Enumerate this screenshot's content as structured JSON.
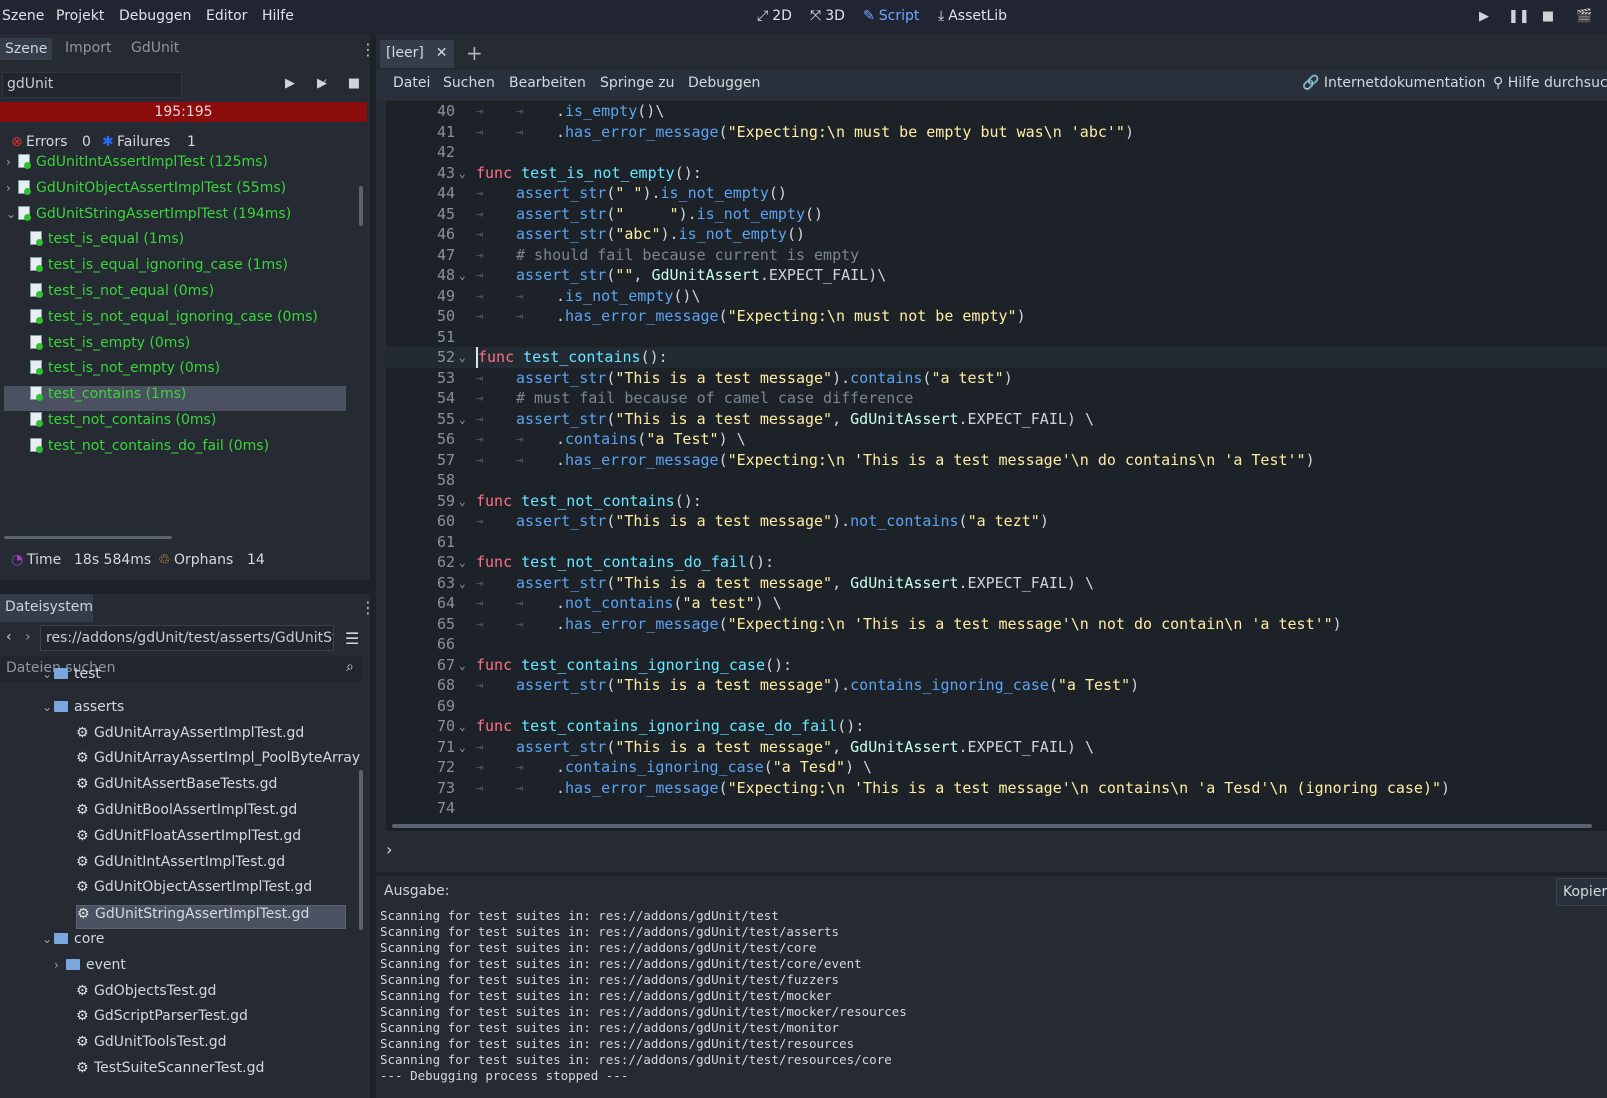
{
  "menu": [
    "Szene",
    "Projekt",
    "Debuggen",
    "Editor",
    "Hilfe"
  ],
  "workspaces": [
    {
      "label": "2D",
      "icon": "2d-icon"
    },
    {
      "label": "3D",
      "icon": "3d-icon"
    },
    {
      "label": "Script",
      "icon": "script-icon",
      "active": true
    },
    {
      "label": "AssetLib",
      "icon": "assetlib-icon"
    }
  ],
  "scene_dock": {
    "tabs": [
      "Szene",
      "Import",
      "GdUnit"
    ],
    "filter_value": "gdUnit",
    "progress_text": "195:195",
    "errors_label": "Errors",
    "errors_count": "0",
    "failures_label": "Failures",
    "failures_count": "1",
    "tests": [
      {
        "label": "GdUnitIntAssertImplTest (125ms)",
        "level": 0,
        "arrow": "›"
      },
      {
        "label": "GdUnitObjectAssertImplTest (55ms)",
        "level": 0,
        "arrow": "›"
      },
      {
        "label": "GdUnitStringAssertImplTest (194ms)",
        "level": 0,
        "arrow": "⌄"
      },
      {
        "label": "test_is_equal (1ms)",
        "level": 1
      },
      {
        "label": "test_is_equal_ignoring_case (1ms)",
        "level": 1
      },
      {
        "label": "test_is_not_equal (0ms)",
        "level": 1
      },
      {
        "label": "test_is_not_equal_ignoring_case (0ms)",
        "level": 1
      },
      {
        "label": "test_is_empty (0ms)",
        "level": 1
      },
      {
        "label": "test_is_not_empty (0ms)",
        "level": 1
      },
      {
        "label": "test_contains (1ms)",
        "level": 1,
        "selected": true
      },
      {
        "label": "test_not_contains (0ms)",
        "level": 1
      },
      {
        "label": "test_not_contains_do_fail (0ms)",
        "level": 1
      }
    ],
    "time_label": "Time",
    "time_value": "18s 584ms",
    "orphans_label": "Orphans",
    "orphans_value": "14"
  },
  "filesystem": {
    "tab": "Dateisystem",
    "path": "res://addons/gdUnit/test/asserts/GdUnitSt",
    "search_placeholder": "Dateien suchen",
    "items": [
      {
        "label": "test",
        "type": "folder",
        "indent": 54,
        "arrow": "⌄"
      },
      {
        "label": "asserts",
        "type": "folder",
        "indent": 54,
        "arrow": "⌄"
      },
      {
        "label": "GdUnitArrayAssertImplTest.gd",
        "type": "file",
        "indent": 76
      },
      {
        "label": "GdUnitArrayAssertImpl_PoolByteArray",
        "type": "file",
        "indent": 76
      },
      {
        "label": "GdUnitAssertBaseTests.gd",
        "type": "file",
        "indent": 76
      },
      {
        "label": "GdUnitBoolAssertImplTest.gd",
        "type": "file",
        "indent": 76
      },
      {
        "label": "GdUnitFloatAssertImplTest.gd",
        "type": "file",
        "indent": 76
      },
      {
        "label": "GdUnitIntAssertImplTest.gd",
        "type": "file",
        "indent": 76
      },
      {
        "label": "GdUnitObjectAssertImplTest.gd",
        "type": "file",
        "indent": 76
      },
      {
        "label": "GdUnitStringAssertImplTest.gd",
        "type": "file",
        "indent": 76,
        "selected": true
      },
      {
        "label": "core",
        "type": "folder",
        "indent": 54,
        "arrow": "⌄"
      },
      {
        "label": "event",
        "type": "folder",
        "indent": 66,
        "arrow": "›"
      },
      {
        "label": "GdObjectsTest.gd",
        "type": "file",
        "indent": 76
      },
      {
        "label": "GdScriptParserTest.gd",
        "type": "file",
        "indent": 76
      },
      {
        "label": "GdUnitToolsTest.gd",
        "type": "file",
        "indent": 76
      },
      {
        "label": "TestSuiteScannerTest.gd",
        "type": "file",
        "indent": 76
      }
    ]
  },
  "editor": {
    "open_tab": "[leer]",
    "menu": [
      "Datei",
      "Suchen",
      "Bearbeiten",
      "Springe zu",
      "Debuggen"
    ],
    "online_docs": "Internetdokumentation",
    "search_help": "Hilfe durchsuc",
    "current_line": 52,
    "lines": [
      {
        "n": 40,
        "indent": 2,
        "code": [
          [
            ".",
            ""
          ],
          [
            "is_empty",
            "mt"
          ],
          [
            "()\\",
            ""
          ]
        ]
      },
      {
        "n": 41,
        "indent": 2,
        "code": [
          [
            ".",
            ""
          ],
          [
            "has_error_message",
            "mt"
          ],
          [
            "(",
            ""
          ],
          [
            "\"Expecting:\\n must be empty but was\\n 'abc'\"",
            "st"
          ],
          [
            ")",
            ""
          ]
        ]
      },
      {
        "n": 42,
        "indent": 0,
        "code": []
      },
      {
        "n": 43,
        "indent": 0,
        "fold": true,
        "code": [
          [
            "func ",
            "kw"
          ],
          [
            "test_is_not_empty",
            "fn"
          ],
          [
            "():",
            ""
          ]
        ]
      },
      {
        "n": 44,
        "indent": 1,
        "code": [
          [
            "assert_str",
            "mt"
          ],
          [
            "(",
            ""
          ],
          [
            "\" \"",
            "st"
          ],
          [
            ").",
            ""
          ],
          [
            "is_not_empty",
            "mt"
          ],
          [
            "()",
            ""
          ]
        ]
      },
      {
        "n": 45,
        "indent": 1,
        "code": [
          [
            "assert_str",
            "mt"
          ],
          [
            "(",
            ""
          ],
          [
            "\"     \"",
            "st"
          ],
          [
            ").",
            ""
          ],
          [
            "is_not_empty",
            "mt"
          ],
          [
            "()",
            ""
          ]
        ]
      },
      {
        "n": 46,
        "indent": 1,
        "code": [
          [
            "assert_str",
            "mt"
          ],
          [
            "(",
            ""
          ],
          [
            "\"abc\"",
            "st"
          ],
          [
            ").",
            ""
          ],
          [
            "is_not_empty",
            "mt"
          ],
          [
            "()",
            ""
          ]
        ]
      },
      {
        "n": 47,
        "indent": 1,
        "code": [
          [
            "# should fail because current is empty",
            "cm"
          ]
        ]
      },
      {
        "n": 48,
        "indent": 1,
        "fold": true,
        "code": [
          [
            "assert_str",
            "mt"
          ],
          [
            "(",
            ""
          ],
          [
            "\"\"",
            "st"
          ],
          [
            ", ",
            ""
          ],
          [
            "GdUnitAssert",
            "cls"
          ],
          [
            ".EXPECT_FAIL)\\",
            ""
          ]
        ]
      },
      {
        "n": 49,
        "indent": 2,
        "code": [
          [
            ".",
            ""
          ],
          [
            "is_not_empty",
            "mt"
          ],
          [
            "()\\",
            ""
          ]
        ]
      },
      {
        "n": 50,
        "indent": 2,
        "code": [
          [
            ".",
            ""
          ],
          [
            "has_error_message",
            "mt"
          ],
          [
            "(",
            ""
          ],
          [
            "\"Expecting:\\n must not be empty\"",
            "st"
          ],
          [
            ")",
            ""
          ]
        ]
      },
      {
        "n": 51,
        "indent": 0,
        "code": []
      },
      {
        "n": 52,
        "indent": 0,
        "fold": true,
        "code": [
          [
            "func ",
            "kw"
          ],
          [
            "test_contains",
            "fn"
          ],
          [
            "():",
            ""
          ]
        ]
      },
      {
        "n": 53,
        "indent": 1,
        "code": [
          [
            "assert_str",
            "mt"
          ],
          [
            "(",
            ""
          ],
          [
            "\"This is a test message\"",
            "st"
          ],
          [
            ").",
            ""
          ],
          [
            "contains",
            "mt"
          ],
          [
            "(",
            ""
          ],
          [
            "\"a test\"",
            "st"
          ],
          [
            ")",
            ""
          ]
        ]
      },
      {
        "n": 54,
        "indent": 1,
        "code": [
          [
            "# must fail because of camel case difference",
            "cm"
          ]
        ]
      },
      {
        "n": 55,
        "indent": 1,
        "fold": true,
        "code": [
          [
            "assert_str",
            "mt"
          ],
          [
            "(",
            ""
          ],
          [
            "\"This is a test message\"",
            "st"
          ],
          [
            ", ",
            ""
          ],
          [
            "GdUnitAssert",
            "cls"
          ],
          [
            ".EXPECT_FAIL) \\",
            ""
          ]
        ]
      },
      {
        "n": 56,
        "indent": 2,
        "code": [
          [
            ".",
            ""
          ],
          [
            "contains",
            "mt"
          ],
          [
            "(",
            ""
          ],
          [
            "\"a Test\"",
            "st"
          ],
          [
            ") \\",
            ""
          ]
        ]
      },
      {
        "n": 57,
        "indent": 2,
        "code": [
          [
            ".",
            ""
          ],
          [
            "has_error_message",
            "mt"
          ],
          [
            "(",
            ""
          ],
          [
            "\"Expecting:\\n 'This is a test message'\\n do contains\\n 'a Test'\"",
            "st"
          ],
          [
            ")",
            ""
          ]
        ]
      },
      {
        "n": 58,
        "indent": 0,
        "code": []
      },
      {
        "n": 59,
        "indent": 0,
        "fold": true,
        "code": [
          [
            "func ",
            "kw"
          ],
          [
            "test_not_contains",
            "fn"
          ],
          [
            "():",
            ""
          ]
        ]
      },
      {
        "n": 60,
        "indent": 1,
        "code": [
          [
            "assert_str",
            "mt"
          ],
          [
            "(",
            ""
          ],
          [
            "\"This is a test message\"",
            "st"
          ],
          [
            ").",
            ""
          ],
          [
            "not_contains",
            "mt"
          ],
          [
            "(",
            ""
          ],
          [
            "\"a tezt\"",
            "st"
          ],
          [
            ")",
            ""
          ]
        ]
      },
      {
        "n": 61,
        "indent": 0,
        "code": []
      },
      {
        "n": 62,
        "indent": 0,
        "fold": true,
        "code": [
          [
            "func ",
            "kw"
          ],
          [
            "test_not_contains_do_fail",
            "fn"
          ],
          [
            "():",
            ""
          ]
        ]
      },
      {
        "n": 63,
        "indent": 1,
        "fold": true,
        "code": [
          [
            "assert_str",
            "mt"
          ],
          [
            "(",
            ""
          ],
          [
            "\"This is a test message\"",
            "st"
          ],
          [
            ", ",
            ""
          ],
          [
            "GdUnitAssert",
            "cls"
          ],
          [
            ".EXPECT_FAIL) \\",
            ""
          ]
        ]
      },
      {
        "n": 64,
        "indent": 2,
        "code": [
          [
            ".",
            ""
          ],
          [
            "not_contains",
            "mt"
          ],
          [
            "(",
            ""
          ],
          [
            "\"a test\"",
            "st"
          ],
          [
            ") \\",
            ""
          ]
        ]
      },
      {
        "n": 65,
        "indent": 2,
        "code": [
          [
            ".",
            ""
          ],
          [
            "has_error_message",
            "mt"
          ],
          [
            "(",
            ""
          ],
          [
            "\"Expecting:\\n 'This is a test message'\\n not do contain\\n 'a test'\"",
            "st"
          ],
          [
            ")",
            ""
          ]
        ]
      },
      {
        "n": 66,
        "indent": 0,
        "code": []
      },
      {
        "n": 67,
        "indent": 0,
        "fold": true,
        "code": [
          [
            "func ",
            "kw"
          ],
          [
            "test_contains_ignoring_case",
            "fn"
          ],
          [
            "():",
            ""
          ]
        ]
      },
      {
        "n": 68,
        "indent": 1,
        "code": [
          [
            "assert_str",
            "mt"
          ],
          [
            "(",
            ""
          ],
          [
            "\"This is a test message\"",
            "st"
          ],
          [
            ").",
            ""
          ],
          [
            "contains_ignoring_case",
            "mt"
          ],
          [
            "(",
            ""
          ],
          [
            "\"a Test\"",
            "st"
          ],
          [
            ")",
            ""
          ]
        ]
      },
      {
        "n": 69,
        "indent": 0,
        "code": []
      },
      {
        "n": 70,
        "indent": 0,
        "fold": true,
        "code": [
          [
            "func ",
            "kw"
          ],
          [
            "test_contains_ignoring_case_do_fail",
            "fn"
          ],
          [
            "():",
            ""
          ]
        ]
      },
      {
        "n": 71,
        "indent": 1,
        "fold": true,
        "code": [
          [
            "assert_str",
            "mt"
          ],
          [
            "(",
            ""
          ],
          [
            "\"This is a test message\"",
            "st"
          ],
          [
            ", ",
            ""
          ],
          [
            "GdUnitAssert",
            "cls"
          ],
          [
            ".EXPECT_FAIL) \\",
            ""
          ]
        ]
      },
      {
        "n": 72,
        "indent": 2,
        "code": [
          [
            ".",
            ""
          ],
          [
            "contains_ignoring_case",
            "mt"
          ],
          [
            "(",
            ""
          ],
          [
            "\"a Tesd\"",
            "st"
          ],
          [
            ") \\",
            ""
          ]
        ]
      },
      {
        "n": 73,
        "indent": 2,
        "code": [
          [
            ".",
            ""
          ],
          [
            "has_error_message",
            "mt"
          ],
          [
            "(",
            ""
          ],
          [
            "\"Expecting:\\n 'This is a test message'\\n contains\\n 'a Tesd'\\n (ignoring case)\"",
            "st"
          ],
          [
            ")",
            ""
          ]
        ]
      },
      {
        "n": 74,
        "indent": 0,
        "code": []
      }
    ]
  },
  "output": {
    "label": "Ausgabe:",
    "copy_label": "Kopier",
    "lines": [
      "Scanning for test suites in: res://addons/gdUnit/test",
      "Scanning for test suites in: res://addons/gdUnit/test/asserts",
      "Scanning for test suites in: res://addons/gdUnit/test/core",
      "Scanning for test suites in: res://addons/gdUnit/test/core/event",
      "Scanning for test suites in: res://addons/gdUnit/test/fuzzers",
      "Scanning for test suites in: res://addons/gdUnit/test/mocker",
      "Scanning for test suites in: res://addons/gdUnit/test/mocker/resources",
      "Scanning for test suites in: res://addons/gdUnit/test/monitor",
      "Scanning for test suites in: res://addons/gdUnit/test/resources",
      "Scanning for test suites in: res://addons/gdUnit/test/resources/core",
      "--- Debugging process stopped ---"
    ]
  },
  "colors": {
    "accent": "#6fa8ff",
    "test_pass": "#3bd43b",
    "progress_fail": "#8a0c0c",
    "error_icon": "#e03030",
    "failure_icon": "#2a6cff",
    "orphan_icon": "#e0a040",
    "time_icon": "#a040c0"
  }
}
